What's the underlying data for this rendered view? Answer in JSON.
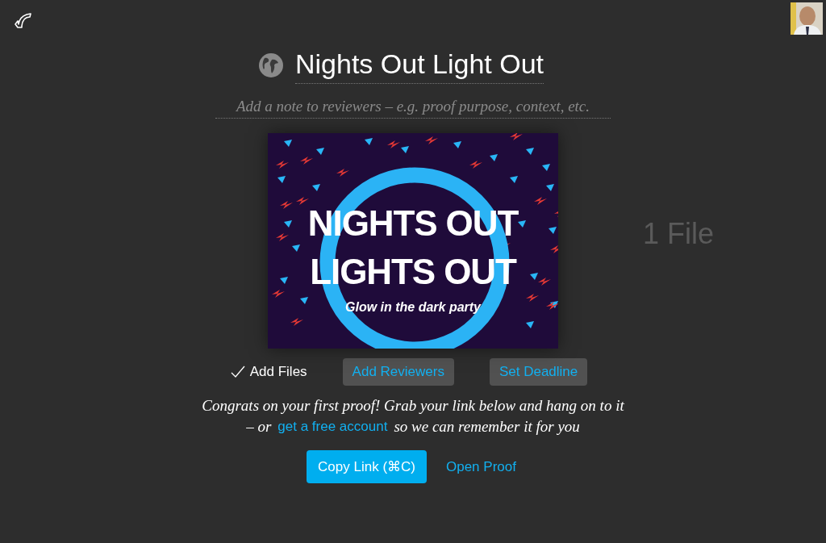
{
  "proof": {
    "title": "Nights Out Light Out",
    "note_placeholder": "Add a note to reviewers – e.g. proof purpose, context, etc.",
    "file_count": "1 File",
    "poster": {
      "headline": [
        "NIGHTS OUT",
        "LIGHTS OUT"
      ],
      "tagline": "Glow in the dark party"
    }
  },
  "steps": [
    {
      "label": "Add Files",
      "done": true
    },
    {
      "label": "Add Reviewers",
      "done": false
    },
    {
      "label": "Set Deadline",
      "done": false
    }
  ],
  "message": {
    "line1": "Congrats on your first proof! Grab your link below and hang on to it",
    "prefix": "– or",
    "link": "get a free account",
    "suffix": "so we can remember it for you"
  },
  "actions": [
    {
      "label": "Copy Link (⌘C)",
      "kind": "primary"
    },
    {
      "label": "Open Proof",
      "kind": "link"
    }
  ]
}
